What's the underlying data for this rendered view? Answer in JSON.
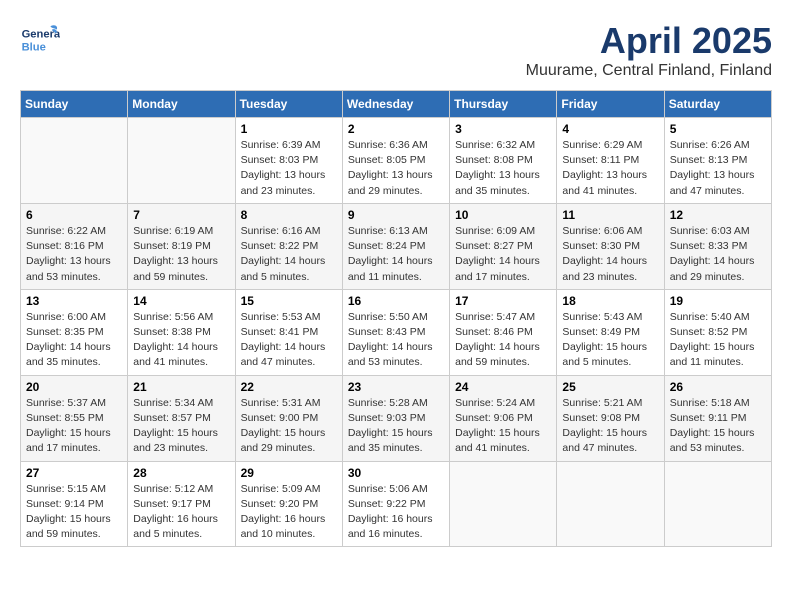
{
  "header": {
    "logo_line1": "General",
    "logo_line2": "Blue",
    "month": "April 2025",
    "location": "Muurame, Central Finland, Finland"
  },
  "weekdays": [
    "Sunday",
    "Monday",
    "Tuesday",
    "Wednesday",
    "Thursday",
    "Friday",
    "Saturday"
  ],
  "weeks": [
    [
      {
        "day": "",
        "info": ""
      },
      {
        "day": "",
        "info": ""
      },
      {
        "day": "1",
        "info": "Sunrise: 6:39 AM\nSunset: 8:03 PM\nDaylight: 13 hours\nand 23 minutes."
      },
      {
        "day": "2",
        "info": "Sunrise: 6:36 AM\nSunset: 8:05 PM\nDaylight: 13 hours\nand 29 minutes."
      },
      {
        "day": "3",
        "info": "Sunrise: 6:32 AM\nSunset: 8:08 PM\nDaylight: 13 hours\nand 35 minutes."
      },
      {
        "day": "4",
        "info": "Sunrise: 6:29 AM\nSunset: 8:11 PM\nDaylight: 13 hours\nand 41 minutes."
      },
      {
        "day": "5",
        "info": "Sunrise: 6:26 AM\nSunset: 8:13 PM\nDaylight: 13 hours\nand 47 minutes."
      }
    ],
    [
      {
        "day": "6",
        "info": "Sunrise: 6:22 AM\nSunset: 8:16 PM\nDaylight: 13 hours\nand 53 minutes."
      },
      {
        "day": "7",
        "info": "Sunrise: 6:19 AM\nSunset: 8:19 PM\nDaylight: 13 hours\nand 59 minutes."
      },
      {
        "day": "8",
        "info": "Sunrise: 6:16 AM\nSunset: 8:22 PM\nDaylight: 14 hours\nand 5 minutes."
      },
      {
        "day": "9",
        "info": "Sunrise: 6:13 AM\nSunset: 8:24 PM\nDaylight: 14 hours\nand 11 minutes."
      },
      {
        "day": "10",
        "info": "Sunrise: 6:09 AM\nSunset: 8:27 PM\nDaylight: 14 hours\nand 17 minutes."
      },
      {
        "day": "11",
        "info": "Sunrise: 6:06 AM\nSunset: 8:30 PM\nDaylight: 14 hours\nand 23 minutes."
      },
      {
        "day": "12",
        "info": "Sunrise: 6:03 AM\nSunset: 8:33 PM\nDaylight: 14 hours\nand 29 minutes."
      }
    ],
    [
      {
        "day": "13",
        "info": "Sunrise: 6:00 AM\nSunset: 8:35 PM\nDaylight: 14 hours\nand 35 minutes."
      },
      {
        "day": "14",
        "info": "Sunrise: 5:56 AM\nSunset: 8:38 PM\nDaylight: 14 hours\nand 41 minutes."
      },
      {
        "day": "15",
        "info": "Sunrise: 5:53 AM\nSunset: 8:41 PM\nDaylight: 14 hours\nand 47 minutes."
      },
      {
        "day": "16",
        "info": "Sunrise: 5:50 AM\nSunset: 8:43 PM\nDaylight: 14 hours\nand 53 minutes."
      },
      {
        "day": "17",
        "info": "Sunrise: 5:47 AM\nSunset: 8:46 PM\nDaylight: 14 hours\nand 59 minutes."
      },
      {
        "day": "18",
        "info": "Sunrise: 5:43 AM\nSunset: 8:49 PM\nDaylight: 15 hours\nand 5 minutes."
      },
      {
        "day": "19",
        "info": "Sunrise: 5:40 AM\nSunset: 8:52 PM\nDaylight: 15 hours\nand 11 minutes."
      }
    ],
    [
      {
        "day": "20",
        "info": "Sunrise: 5:37 AM\nSunset: 8:55 PM\nDaylight: 15 hours\nand 17 minutes."
      },
      {
        "day": "21",
        "info": "Sunrise: 5:34 AM\nSunset: 8:57 PM\nDaylight: 15 hours\nand 23 minutes."
      },
      {
        "day": "22",
        "info": "Sunrise: 5:31 AM\nSunset: 9:00 PM\nDaylight: 15 hours\nand 29 minutes."
      },
      {
        "day": "23",
        "info": "Sunrise: 5:28 AM\nSunset: 9:03 PM\nDaylight: 15 hours\nand 35 minutes."
      },
      {
        "day": "24",
        "info": "Sunrise: 5:24 AM\nSunset: 9:06 PM\nDaylight: 15 hours\nand 41 minutes."
      },
      {
        "day": "25",
        "info": "Sunrise: 5:21 AM\nSunset: 9:08 PM\nDaylight: 15 hours\nand 47 minutes."
      },
      {
        "day": "26",
        "info": "Sunrise: 5:18 AM\nSunset: 9:11 PM\nDaylight: 15 hours\nand 53 minutes."
      }
    ],
    [
      {
        "day": "27",
        "info": "Sunrise: 5:15 AM\nSunset: 9:14 PM\nDaylight: 15 hours\nand 59 minutes."
      },
      {
        "day": "28",
        "info": "Sunrise: 5:12 AM\nSunset: 9:17 PM\nDaylight: 16 hours\nand 5 minutes."
      },
      {
        "day": "29",
        "info": "Sunrise: 5:09 AM\nSunset: 9:20 PM\nDaylight: 16 hours\nand 10 minutes."
      },
      {
        "day": "30",
        "info": "Sunrise: 5:06 AM\nSunset: 9:22 PM\nDaylight: 16 hours\nand 16 minutes."
      },
      {
        "day": "",
        "info": ""
      },
      {
        "day": "",
        "info": ""
      },
      {
        "day": "",
        "info": ""
      }
    ]
  ]
}
